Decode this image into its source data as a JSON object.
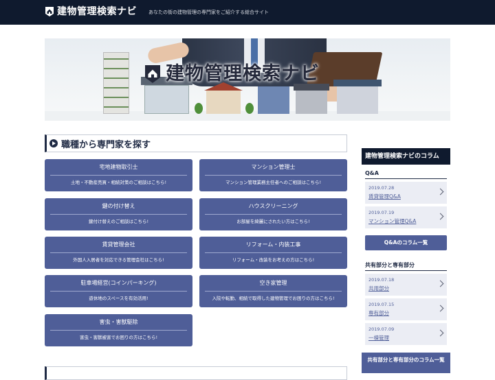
{
  "header": {
    "logo_text": "建物管理検索ナビ",
    "tagline": "あなたの街の建物管理の専門家をご紹介する総合サイト",
    "bg_color": "#0f1a2e"
  },
  "hero": {
    "title": "建物管理検索ナビ",
    "icon": "house-shield-logo-icon"
  },
  "main": {
    "section_title": "職種から専門家を探す",
    "section_icon": "play-circle-icon",
    "card_color": "#4f5e98",
    "cards": [
      {
        "title": "宅地建物取引士",
        "desc": "土地・不動産売買・相続対策のご相談はこちら!"
      },
      {
        "title": "マンション管理士",
        "desc": "マンション管理業務主任者へのご相談はこちら!"
      },
      {
        "title": "鍵の付け替え",
        "desc": "鍵付け替えのご相談はこちら!"
      },
      {
        "title": "ハウスクリーニング",
        "desc": "お部屋を綺麗にされたい方はこちら!"
      },
      {
        "title": "賃貸管理会社",
        "desc": "外国人入居者を対応できる管理会社はこちら!"
      },
      {
        "title": "リフォーム・内装工事",
        "desc": "リフォーム・改装をお考えの方はこちら!"
      },
      {
        "title": "駐車場経営(コインパーキング)",
        "desc": "遊休地のスペースを有効活用!"
      },
      {
        "title": "空き家管理",
        "desc": "入院や転勤、相続で取得した建物管理でお困りの方はこちら!"
      },
      {
        "title": "害虫・害獣駆除",
        "desc": "害虫・害獣被害でお困りの方はこちら!"
      }
    ]
  },
  "sidebar": {
    "title": "建物管理検索ナビのコラム",
    "qa": {
      "heading": "Q&A",
      "items": [
        {
          "date": "2019.07.28",
          "title": "賃貸管理Q&A"
        },
        {
          "date": "2019.07.19",
          "title": "マンション管理Q&A"
        }
      ],
      "button": "Q&Aのコラム一覧"
    },
    "shared": {
      "heading": "共有部分と専有部分",
      "items": [
        {
          "date": "2019.07.18",
          "title": "共用部分"
        },
        {
          "date": "2019.07.15",
          "title": "専有部分"
        },
        {
          "date": "2019.07.09",
          "title": "一棟管理"
        }
      ],
      "button": "共有部分と専有部分のコラム一覧"
    }
  }
}
